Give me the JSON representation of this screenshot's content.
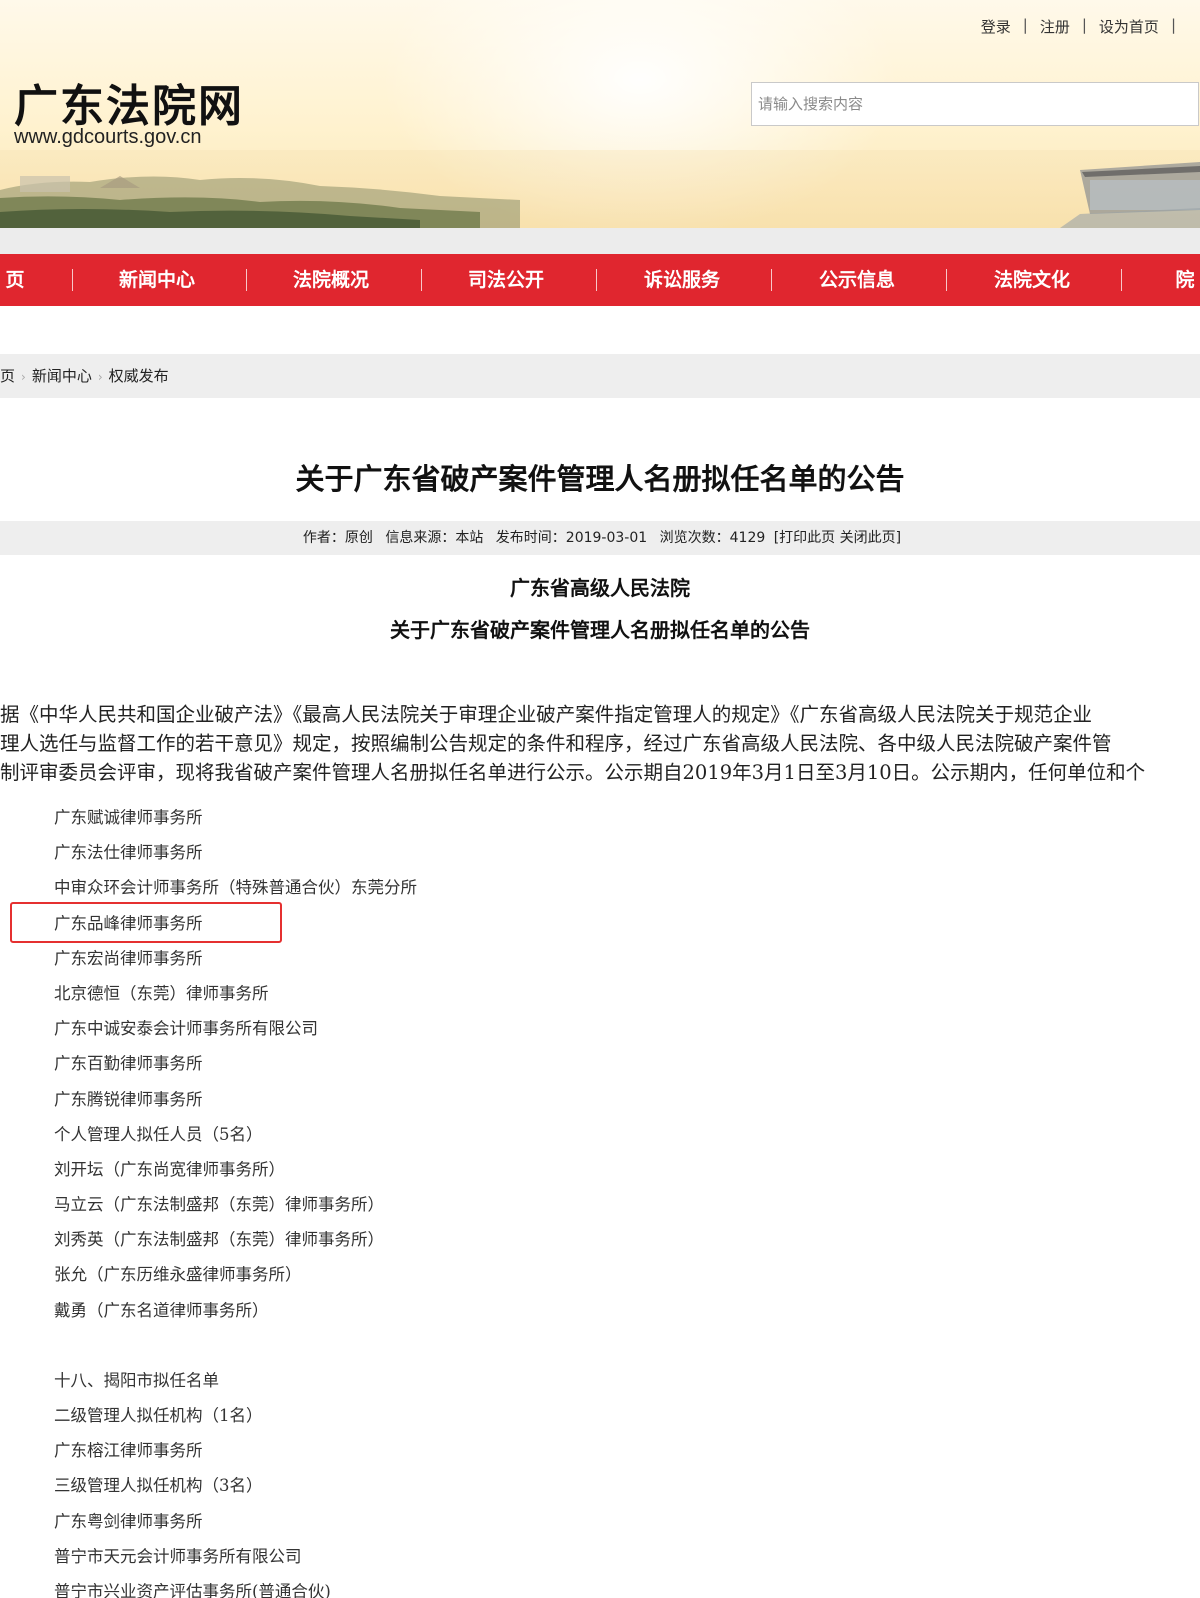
{
  "header": {
    "top_links": [
      "登录",
      "注册",
      "设为首页"
    ],
    "logo_text": "广东法院网",
    "logo_url": "www.gdcourts.gov.cn",
    "search_placeholder": "请输入搜索内容"
  },
  "nav": {
    "items": [
      "页",
      "新闻中心",
      "法院概况",
      "司法公开",
      "诉讼服务",
      "公示信息",
      "法院文化",
      "院"
    ]
  },
  "breadcrumb": [
    "页",
    "新闻中心",
    "权威发布"
  ],
  "article": {
    "title": "关于广东省破产案件管理人名册拟任名单的公告",
    "meta": {
      "author": "作者：原创",
      "source": "信息来源：本站",
      "date": "发布时间：2019-03-01",
      "views": "浏览次数：4129",
      "print": "[打印此页",
      "close": "关闭此页]"
    },
    "org": "广东省高级人民法院",
    "subtitle": "关于广东省破产案件管理人名册拟任名单的公告",
    "intro_lines": [
      "据《中华人民共和国企业破产法》《最高人民法院关于审理企业破产案件指定管理人的规定》《广东省高级人民法院关于规范企业",
      "理人选任与监督工作的若干意见》规定，按照编制公告规定的条件和程序，经过广东省高级人民法院、各中级人民法院破产案件管",
      "制评审委员会评审，现将我省破产案件管理人名册拟任名单进行公示。公示期自2019年3月1日至3月10日。公示期内，任何单位和个"
    ],
    "list_a": [
      "广东赋诚律师事务所",
      "广东法仕律师事务所",
      "中审众环会计师事务所（特殊普通合伙）东莞分所",
      "广东品峰律师事务所",
      "广东宏尚律师事务所",
      "北京德恒（东莞）律师事务所",
      "广东中诚安泰会计师事务所有限公司",
      "广东百勤律师事务所",
      "广东腾锐律师事务所",
      "个人管理人拟任人员（5名）",
      "刘开坛（广东尚宽律师事务所）",
      "马立云（广东法制盛邦（东莞）律师事务所）",
      "刘秀英（广东法制盛邦（东莞）律师事务所）",
      "张允（广东历维永盛律师事务所）",
      "戴勇（广东名道律师事务所）"
    ],
    "list_b": [
      "十八、揭阳市拟任名单",
      "二级管理人拟任机构（1名）",
      "广东榕江律师事务所",
      "三级管理人拟任机构（3名）",
      "广东粤剑律师事务所",
      "普宁市天元会计师事务所有限公司",
      "普宁市兴业资产评估事务所(普通合伙)"
    ]
  },
  "colors": {
    "nav_red": "#e0262f",
    "highlight_red": "#e53030"
  }
}
